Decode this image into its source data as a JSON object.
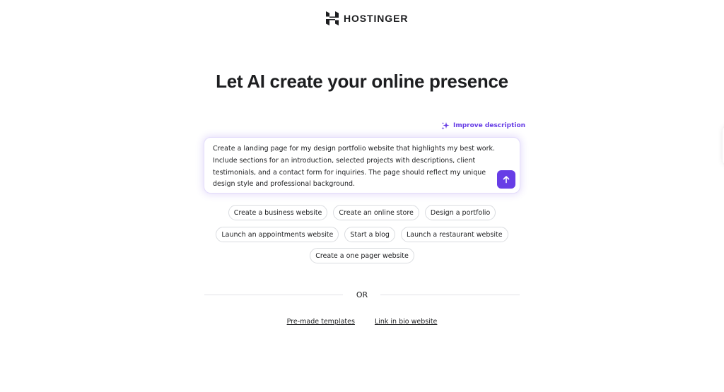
{
  "brand": {
    "name": "HOSTINGER",
    "logo_icon": "hostinger-logo-icon"
  },
  "headline": "Let AI create your online presence",
  "improve_description": {
    "label": "Improve description",
    "icon": "sparkle-icon"
  },
  "prompt": {
    "value": "Create a landing page for my design portfolio website that highlights my best work. Include sections for an introduction, selected projects with descriptions, client testimonials, and a contact form for inquiries. The page should reflect my unique design style and professional background.",
    "submit_icon": "arrow-up-icon"
  },
  "suggestions": {
    "row1": [
      "Create a business website",
      "Create an online store",
      "Design a portfolio"
    ],
    "row2": [
      "Launch an appointments website",
      "Start a blog",
      "Launch a restaurant website"
    ],
    "row3": [
      "Create a one pager website"
    ]
  },
  "separator_label": "OR",
  "links": [
    "Pre-made templates",
    "Link in bio website"
  ],
  "colors": {
    "accent": "#673de6",
    "text": "#1d1e20",
    "border": "#dadce0"
  }
}
